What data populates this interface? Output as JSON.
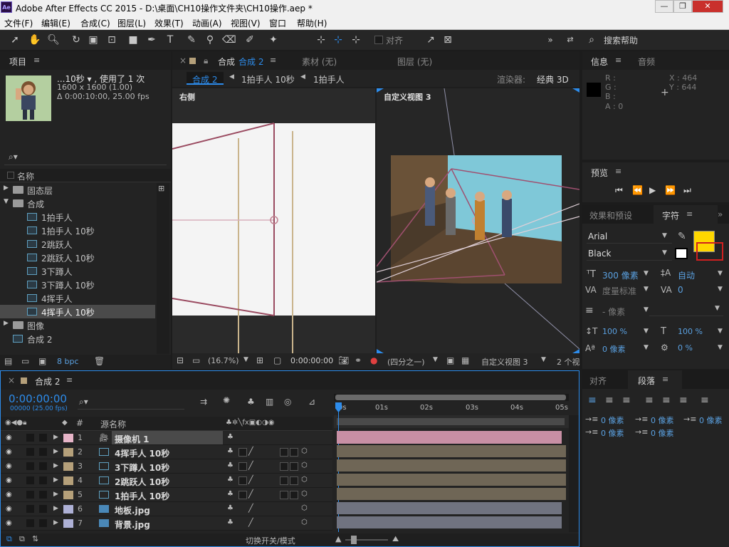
{
  "app": {
    "title": "Adobe After Effects CC 2015 - D:\\桌面\\CH10操作文件夹\\CH10操作.aep *",
    "logo": "Ae",
    "win_min": "—",
    "win_max": "❐",
    "win_close": "✕"
  },
  "menu": [
    "文件(F)",
    "编辑(E)",
    "合成(C)",
    "图层(L)",
    "效果(T)",
    "动画(A)",
    "视图(V)",
    "窗口",
    "帮助(H)"
  ],
  "toolbar": {
    "align_label": "对齐",
    "search_help": "搜索帮助"
  },
  "project": {
    "tab": "项目",
    "name": "...10秒 ▾ , 使用了 1 次",
    "dims": "1600 x 1600 (1.00)",
    "duration": "Δ 0:00:10:00, 25.00 fps",
    "search_placeholder": "",
    "col_name": "名称",
    "bpc": "8 bpc",
    "items": [
      {
        "label": "固态层",
        "type": "folder",
        "open": false
      },
      {
        "label": "合成",
        "type": "folder",
        "open": true
      },
      {
        "label": "1拍手人",
        "type": "comp"
      },
      {
        "label": "1拍手人 10秒",
        "type": "comp"
      },
      {
        "label": "2跳跃人",
        "type": "comp"
      },
      {
        "label": "2跳跃人 10秒",
        "type": "comp"
      },
      {
        "label": "3下蹲人",
        "type": "comp"
      },
      {
        "label": "3下蹲人 10秒",
        "type": "comp"
      },
      {
        "label": "4挥手人",
        "type": "comp"
      },
      {
        "label": "4挥手人 10秒",
        "type": "comp",
        "selected": true
      },
      {
        "label": "图像",
        "type": "folder",
        "open": false
      },
      {
        "label": "合成 2",
        "type": "comp"
      }
    ]
  },
  "comp_viewer": {
    "tab_prefix": "合成",
    "tab_name": "合成 2",
    "footage_tab": "素材 (无)",
    "layer_tab": "图层 (无)",
    "breadcrumb": [
      "合成 2",
      "1拍手人 10秒",
      "1拍手人"
    ],
    "renderer_label": "渲染器:",
    "renderer": "经典 3D",
    "left_view_label": "右侧",
    "right_view_label": "自定义视图 3",
    "zoom": "(16.7%)",
    "timecode": "0:00:00:00",
    "resolution": "(四分之一)",
    "view_select": "自定义视图 3",
    "views_count": "2 个视"
  },
  "info": {
    "tab": "信息",
    "audio_tab": "音频",
    "r": "R :",
    "g": "G :",
    "b": "B :",
    "a": "A : 0",
    "x": "X : 464",
    "y": "Y : 644"
  },
  "preview": {
    "tab": "预览"
  },
  "character": {
    "effects_tab": "效果和预设",
    "tab": "字符",
    "font": "Arial",
    "style": "Black",
    "size": "300 像素",
    "leading": "自动",
    "kerning": "度量标准",
    "tracking": "0",
    "stroke": "- 像素",
    "vscale": "100 %",
    "hscale": "100 %",
    "baseline": "0 像素",
    "tsume": "0 %",
    "fill_color": "#ffd700"
  },
  "paragraph": {
    "align_tab": "对齐",
    "tab": "段落",
    "indent_left": "0 像素",
    "indent_first": "0 像素",
    "indent_right": "0 像素",
    "space_before": "0 像素",
    "space_after": "0 像素"
  },
  "timeline": {
    "tab": "合成 2",
    "timecode": "0:00:00:00",
    "fps": "00000 (25.00 fps)",
    "col_num": "#",
    "col_name": "源名称",
    "toggle_label": "切换开关/模式",
    "ruler": [
      "0s",
      "01s",
      "02s",
      "03s",
      "04s",
      "05s"
    ],
    "layers": [
      {
        "num": "1",
        "name": "摄像机 1",
        "label_color": "#e7b5c8",
        "bar_color": "#c88fa4",
        "selected": true
      },
      {
        "num": "2",
        "name": "4挥手人 10秒",
        "label_color": "#b5a07a",
        "bar_color": "#6f6656"
      },
      {
        "num": "3",
        "name": "3下蹲人 10秒",
        "label_color": "#b5a07a",
        "bar_color": "#6f6656"
      },
      {
        "num": "4",
        "name": "2跳跃人 10秒",
        "label_color": "#b5a07a",
        "bar_color": "#6f6656"
      },
      {
        "num": "5",
        "name": "1拍手人 10秒",
        "label_color": "#b5a07a",
        "bar_color": "#6f6656"
      },
      {
        "num": "6",
        "name": "地板.jpg",
        "label_color": "#aeb1d6",
        "bar_color": "#707380"
      },
      {
        "num": "7",
        "name": "背景.jpg",
        "label_color": "#aeb1d6",
        "bar_color": "#707380"
      }
    ]
  },
  "colors": {
    "accent": "#2d8ceb",
    "timecode": "#2d8ceb"
  }
}
